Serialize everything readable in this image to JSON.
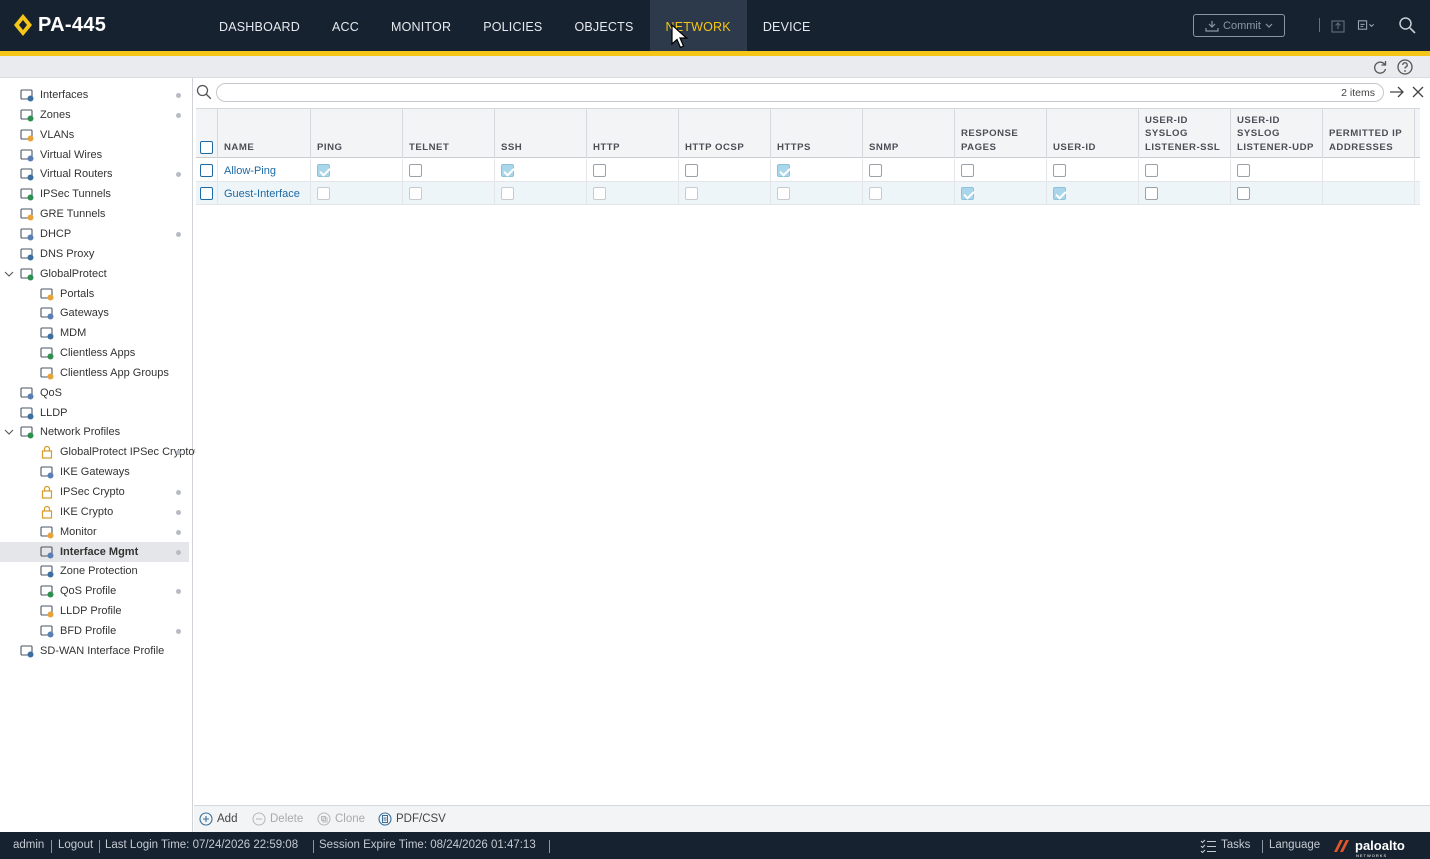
{
  "header": {
    "device_name": "PA-445",
    "nav": [
      "DASHBOARD",
      "ACC",
      "MONITOR",
      "POLICIES",
      "OBJECTS",
      "NETWORK",
      "DEVICE"
    ],
    "active_nav": "NETWORK",
    "commit_label": "Commit",
    "accent_color": "#f5c518",
    "header_bg": "#172230"
  },
  "sidebar": {
    "items": [
      {
        "label": "Interfaces",
        "icon": "interfaces-icon",
        "dot": true,
        "level": 0
      },
      {
        "label": "Zones",
        "icon": "zones-icon",
        "dot": true,
        "level": 0
      },
      {
        "label": "VLANs",
        "icon": "vlans-icon",
        "dot": false,
        "level": 0
      },
      {
        "label": "Virtual Wires",
        "icon": "virtual-wires-icon",
        "dot": false,
        "level": 0
      },
      {
        "label": "Virtual Routers",
        "icon": "virtual-routers-icon",
        "dot": true,
        "level": 0
      },
      {
        "label": "IPSec Tunnels",
        "icon": "ipsec-tunnels-icon",
        "dot": false,
        "level": 0
      },
      {
        "label": "GRE Tunnels",
        "icon": "gre-tunnels-icon",
        "dot": false,
        "level": 0
      },
      {
        "label": "DHCP",
        "icon": "dhcp-icon",
        "dot": true,
        "level": 0
      },
      {
        "label": "DNS Proxy",
        "icon": "dns-proxy-icon",
        "dot": false,
        "level": 0
      },
      {
        "label": "GlobalProtect",
        "icon": "globalprotect-icon",
        "dot": false,
        "level": 0,
        "expanded": true
      },
      {
        "label": "Portals",
        "icon": "portals-icon",
        "dot": false,
        "level": 1
      },
      {
        "label": "Gateways",
        "icon": "gateways-icon",
        "dot": false,
        "level": 1
      },
      {
        "label": "MDM",
        "icon": "mdm-icon",
        "dot": false,
        "level": 1
      },
      {
        "label": "Clientless Apps",
        "icon": "clientless-apps-icon",
        "dot": false,
        "level": 1
      },
      {
        "label": "Clientless App Groups",
        "icon": "clientless-app-groups-icon",
        "dot": false,
        "level": 1
      },
      {
        "label": "QoS",
        "icon": "qos-icon",
        "dot": false,
        "level": 0
      },
      {
        "label": "LLDP",
        "icon": "lldp-icon",
        "dot": false,
        "level": 0
      },
      {
        "label": "Network Profiles",
        "icon": "network-profiles-icon",
        "dot": false,
        "level": 0,
        "expanded": true
      },
      {
        "label": "GlobalProtect IPSec Crypto",
        "icon": "lock-icon",
        "dot": true,
        "level": 1
      },
      {
        "label": "IKE Gateways",
        "icon": "ike-gateways-icon",
        "dot": false,
        "level": 1
      },
      {
        "label": "IPSec Crypto",
        "icon": "lock-icon",
        "dot": true,
        "level": 1
      },
      {
        "label": "IKE Crypto",
        "icon": "lock-icon",
        "dot": true,
        "level": 1
      },
      {
        "label": "Monitor",
        "icon": "monitor-icon",
        "dot": true,
        "level": 1
      },
      {
        "label": "Interface Mgmt",
        "icon": "interface-mgmt-icon",
        "dot": true,
        "level": 1,
        "selected": true
      },
      {
        "label": "Zone Protection",
        "icon": "zone-protection-icon",
        "dot": false,
        "level": 1
      },
      {
        "label": "QoS Profile",
        "icon": "qos-profile-icon",
        "dot": true,
        "level": 1
      },
      {
        "label": "LLDP Profile",
        "icon": "lldp-profile-icon",
        "dot": false,
        "level": 1
      },
      {
        "label": "BFD Profile",
        "icon": "bfd-profile-icon",
        "dot": true,
        "level": 1
      },
      {
        "label": "SD-WAN Interface Profile",
        "icon": "sdwan-interface-profile-icon",
        "dot": false,
        "level": 0
      }
    ]
  },
  "search": {
    "placeholder": "",
    "count": "2 items"
  },
  "table": {
    "columns": [
      "NAME",
      "PING",
      "TELNET",
      "SSH",
      "HTTP",
      "HTTP OCSP",
      "HTTPS",
      "SNMP",
      "RESPONSE PAGES",
      "USER-ID",
      "USER-ID SYSLOG LISTENER-SSL",
      "USER-ID SYSLOG LISTENER-UDP",
      "PERMITTED IP ADDRESSES"
    ],
    "rows": [
      {
        "name": "Allow-Ping",
        "flags": [
          true,
          false,
          true,
          false,
          false,
          true,
          false,
          false,
          false,
          false,
          false
        ],
        "permitted": ""
      },
      {
        "name": "Guest-Interface",
        "flags": [
          false,
          false,
          false,
          false,
          false,
          false,
          false,
          true,
          true,
          false,
          false
        ],
        "permitted": ""
      }
    ]
  },
  "actions": {
    "add": "Add",
    "delete": "Delete",
    "clone": "Clone",
    "pdfcsv": "PDF/CSV"
  },
  "status": {
    "user": "admin",
    "logout": "Logout",
    "last_login": "Last Login Time: 07/24/2026 22:59:08",
    "session_expire": "Session Expire Time: 08/24/2026 01:47:13",
    "tasks": "Tasks",
    "language": "Language",
    "brand": "paloalto",
    "brand_sub": "NETWORKS"
  }
}
